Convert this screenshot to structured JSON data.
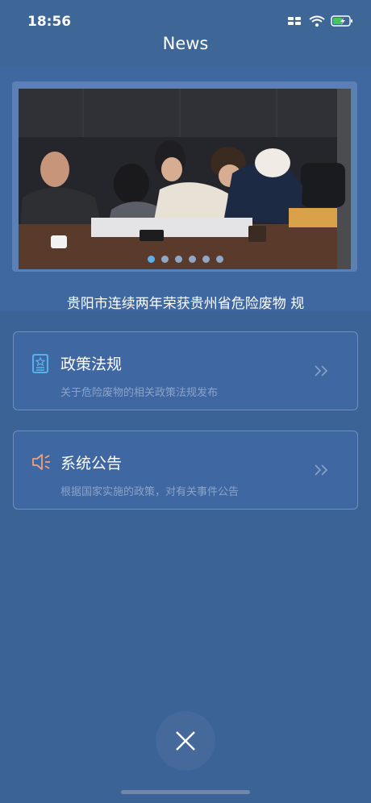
{
  "status": {
    "time": "18:56"
  },
  "nav": {
    "title": "News"
  },
  "banner": {
    "dots": 6,
    "active_index": 0
  },
  "headline": "贵阳市连续两年荣获贵州省危险废物 规",
  "cards": [
    {
      "title": "政策法规",
      "subtitle": "关于危险废物的相关政策法规发布",
      "icon": "document-icon"
    },
    {
      "title": "系统公告",
      "subtitle": "根据国家实施的政策，对有关事件公告",
      "icon": "speaker-icon"
    }
  ],
  "colors": {
    "background": "#3b6396",
    "accent": "#5ab0ea",
    "battery": "#3ec95a"
  }
}
